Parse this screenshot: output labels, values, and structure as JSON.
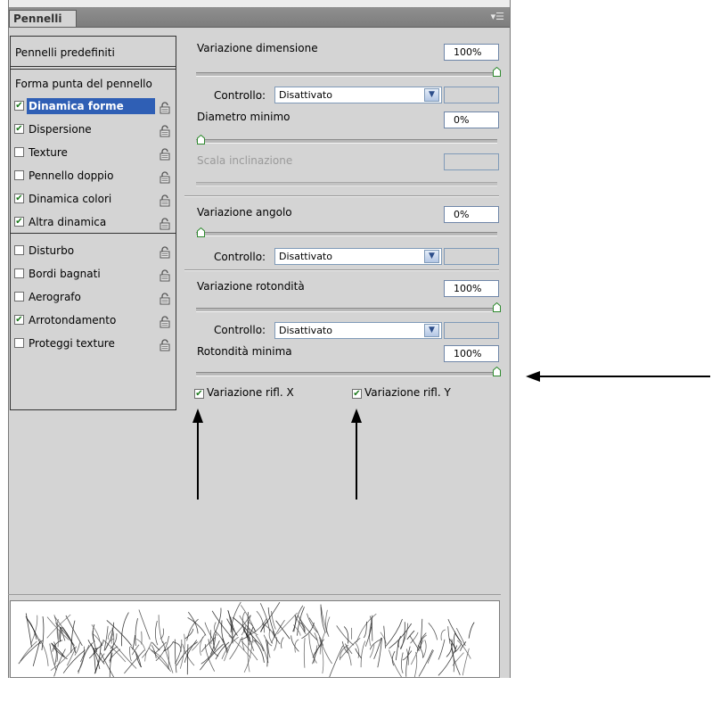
{
  "panel": {
    "tab_title": "Pennelli",
    "menu_icon": "panel-menu-icon"
  },
  "sidebar": {
    "preset_label": "Pennelli predefiniti",
    "tip_shape_label": "Forma punta del pennello",
    "items": [
      {
        "label": "Dinamica forme",
        "checked": true,
        "selected": true
      },
      {
        "label": "Dispersione",
        "checked": true,
        "selected": false
      },
      {
        "label": "Texture",
        "checked": false,
        "selected": false
      },
      {
        "label": "Pennello doppio",
        "checked": false,
        "selected": false
      },
      {
        "label": "Dinamica colori",
        "checked": true,
        "selected": false
      },
      {
        "label": "Altra dinamica",
        "checked": true,
        "selected": false
      },
      {
        "label": "Disturbo",
        "checked": false,
        "selected": false
      },
      {
        "label": "Bordi bagnati",
        "checked": false,
        "selected": false
      },
      {
        "label": "Aerografo",
        "checked": false,
        "selected": false
      },
      {
        "label": "Arrotondamento",
        "checked": true,
        "selected": false
      },
      {
        "label": "Proteggi texture",
        "checked": false,
        "selected": false
      }
    ]
  },
  "settings": {
    "size_jitter": {
      "label": "Variazione dimensione",
      "value": "100%",
      "slider": 1.0
    },
    "size_control": {
      "label": "Controllo:",
      "value": "Disattivato"
    },
    "min_diameter": {
      "label": "Diametro minimo",
      "value": "0%",
      "slider": 0.0
    },
    "tilt_scale": {
      "label": "Scala inclinazione"
    },
    "angle_jitter": {
      "label": "Variazione angolo",
      "value": "0%",
      "slider": 0.0
    },
    "angle_control": {
      "label": "Controllo:",
      "value": "Disattivato"
    },
    "roundness_jitter": {
      "label": "Variazione rotondità",
      "value": "100%",
      "slider": 1.0
    },
    "roundness_control": {
      "label": "Controllo:",
      "value": "Disattivato"
    },
    "min_roundness": {
      "label": "Rotondità minima",
      "value": "100%",
      "slider": 1.0
    },
    "flip_x": {
      "label": "Variazione rifl. X",
      "checked": true
    },
    "flip_y": {
      "label": "Variazione rifl. Y",
      "checked": true
    }
  },
  "colors": {
    "panel_bg": "#d4d4d4",
    "selection": "#2f5fb5",
    "check": "#1d7a1d"
  }
}
